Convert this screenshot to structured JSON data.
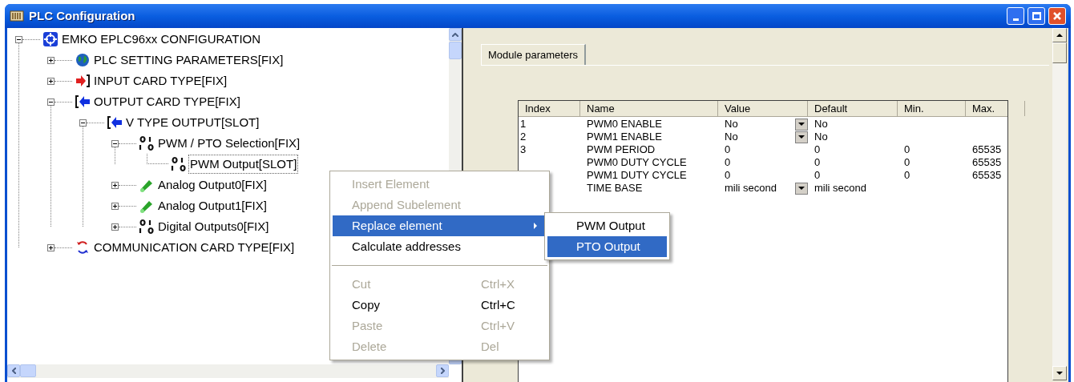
{
  "window": {
    "title": "PLC Configuration"
  },
  "tree": [
    {
      "label": "EMKO EPLC96xx CONFIGURATION",
      "kind": "chip",
      "expanded": true,
      "selected": false,
      "children": [
        {
          "label": "PLC SETTING PARAMETERS[FIX]",
          "kind": "globe",
          "expanded": false,
          "selected": false
        },
        {
          "label": "INPUT CARD TYPE[FIX]",
          "kind": "input",
          "expanded": false,
          "selected": false
        },
        {
          "label": "OUTPUT CARD TYPE[FIX]",
          "kind": "output",
          "expanded": true,
          "selected": false,
          "children": [
            {
              "label": "V TYPE OUTPUT[SLOT]",
              "kind": "output",
              "expanded": true,
              "selected": false,
              "children": [
                {
                  "label": "PWM / PTO Selection[FIX]",
                  "kind": "bits",
                  "expanded": true,
                  "selected": false,
                  "children": [
                    {
                      "label": "PWM Output[SLOT]",
                      "kind": "bits",
                      "selected": true
                    }
                  ]
                },
                {
                  "label": "Analog Output0[FIX]",
                  "kind": "analog",
                  "expanded": false,
                  "selected": false
                },
                {
                  "label": "Analog Output1[FIX]",
                  "kind": "analog",
                  "expanded": false,
                  "selected": false
                },
                {
                  "label": "Digital Outputs0[FIX]",
                  "kind": "bits",
                  "expanded": false,
                  "selected": false
                }
              ]
            }
          ]
        },
        {
          "label": "COMMUNICATION CARD TYPE[FIX]",
          "kind": "comm",
          "expanded": false,
          "selected": false
        }
      ]
    }
  ],
  "tabs": [
    {
      "label": "Module parameters",
      "selected": true
    }
  ],
  "table": {
    "columns": [
      "Index",
      "Name",
      "Value",
      "Default",
      "Min.",
      "Max."
    ],
    "rows": [
      {
        "index": "1",
        "name": "PWM0 ENABLE",
        "value": "No",
        "dropdown": true,
        "default": "No",
        "min": "",
        "max": ""
      },
      {
        "index": "2",
        "name": "PWM1 ENABLE",
        "value": "No",
        "dropdown": true,
        "default": "No",
        "min": "",
        "max": ""
      },
      {
        "index": "3",
        "name": "PWM PERIOD",
        "value": "0",
        "dropdown": false,
        "default": "0",
        "min": "0",
        "max": "65535"
      },
      {
        "name": "PWM0 DUTY CYCLE",
        "value": "0",
        "dropdown": false,
        "default": "0",
        "min": "0",
        "max": "65535"
      },
      {
        "name": "PWM1 DUTY CYCLE",
        "value": "0",
        "dropdown": false,
        "default": "0",
        "min": "0",
        "max": "65535"
      },
      {
        "name": "TIME BASE",
        "value": "mili second",
        "dropdown": true,
        "default": "mili second",
        "min": "",
        "max": ""
      }
    ]
  },
  "context_menu": {
    "items": [
      {
        "kind": "item",
        "label": "Insert Element",
        "disabled": true,
        "selected": false
      },
      {
        "kind": "item",
        "label": "Append Subelement",
        "disabled": true,
        "selected": false
      },
      {
        "kind": "submenu",
        "label": "Replace element",
        "disabled": false,
        "selected": true
      },
      {
        "kind": "item",
        "label": "Calculate addresses",
        "disabled": false,
        "selected": false
      },
      {
        "kind": "separator"
      },
      {
        "kind": "item",
        "label": "Cut",
        "shortcut": "Ctrl+X",
        "disabled": true,
        "selected": false
      },
      {
        "kind": "item",
        "label": "Copy",
        "shortcut": "Ctrl+C",
        "disabled": false,
        "selected": false
      },
      {
        "kind": "item",
        "label": "Paste",
        "shortcut": "Ctrl+V",
        "disabled": true,
        "selected": false
      },
      {
        "kind": "item",
        "label": "Delete",
        "shortcut": "Del",
        "disabled": true,
        "selected": false
      }
    ],
    "submenu": [
      {
        "label": "PWM Output",
        "selected": false
      },
      {
        "label": "PTO Output",
        "selected": true
      }
    ]
  }
}
